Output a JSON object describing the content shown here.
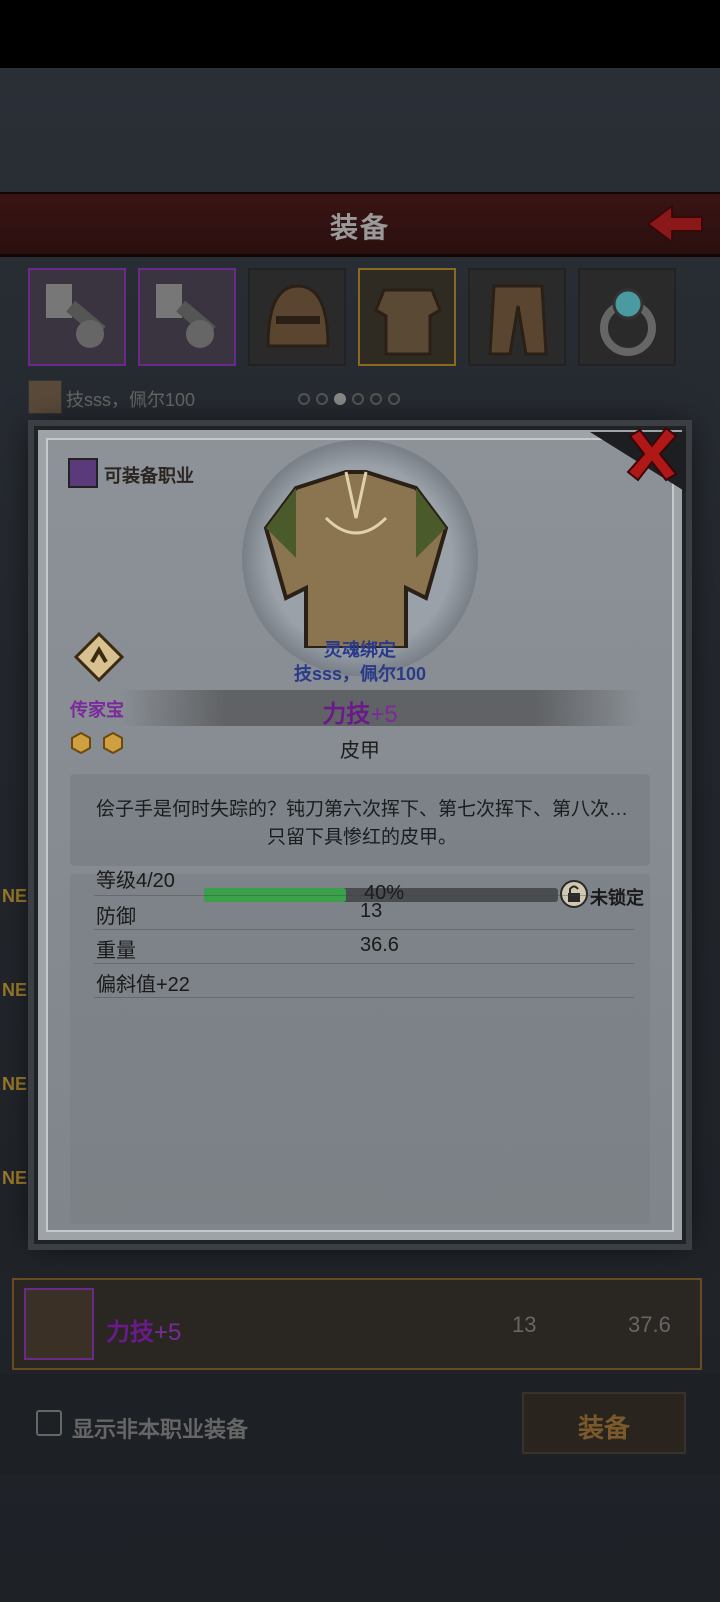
{
  "header": {
    "title": "装备"
  },
  "owner": {
    "text": "技sss，佩尔100"
  },
  "modal": {
    "class_label": "可装备职业",
    "soulbound": "灵魂绑定",
    "owner": "技sss，佩尔100",
    "rarity": "传家宝",
    "main_stat_name": "力技",
    "main_stat_value": "+5",
    "item_type": "皮甲",
    "description": "侩子手是何时失踪的？钝刀第六次挥下、第七次挥下、第八次…只留下具惨红的皮甲。",
    "level_label": "等级4/20",
    "level_progress": 0.4,
    "level_percent": "40%",
    "lock_label": "未锁定",
    "stats": [
      {
        "name": "防御",
        "value": "13"
      },
      {
        "name": "重量",
        "value": "36.6"
      },
      {
        "name": "偏斜值+22",
        "value": ""
      }
    ]
  },
  "new_tag": "NE",
  "selected_item": {
    "stat_name": "力技",
    "stat_value": "+5",
    "defense": "13",
    "weight": "37.6"
  },
  "footer": {
    "checkbox_label": "显示非本职业装备",
    "equip_button": "装备"
  },
  "icons": [
    "back-arrow-icon",
    "close-icon",
    "class-icon",
    "heirloom-icon",
    "lock-icon",
    "hex-icon"
  ],
  "colors": {
    "heirloom": "#7a2a9a",
    "soulbound": "#2a3a8a",
    "progress": "#3aa04a",
    "title_bar": "#3a1414"
  }
}
